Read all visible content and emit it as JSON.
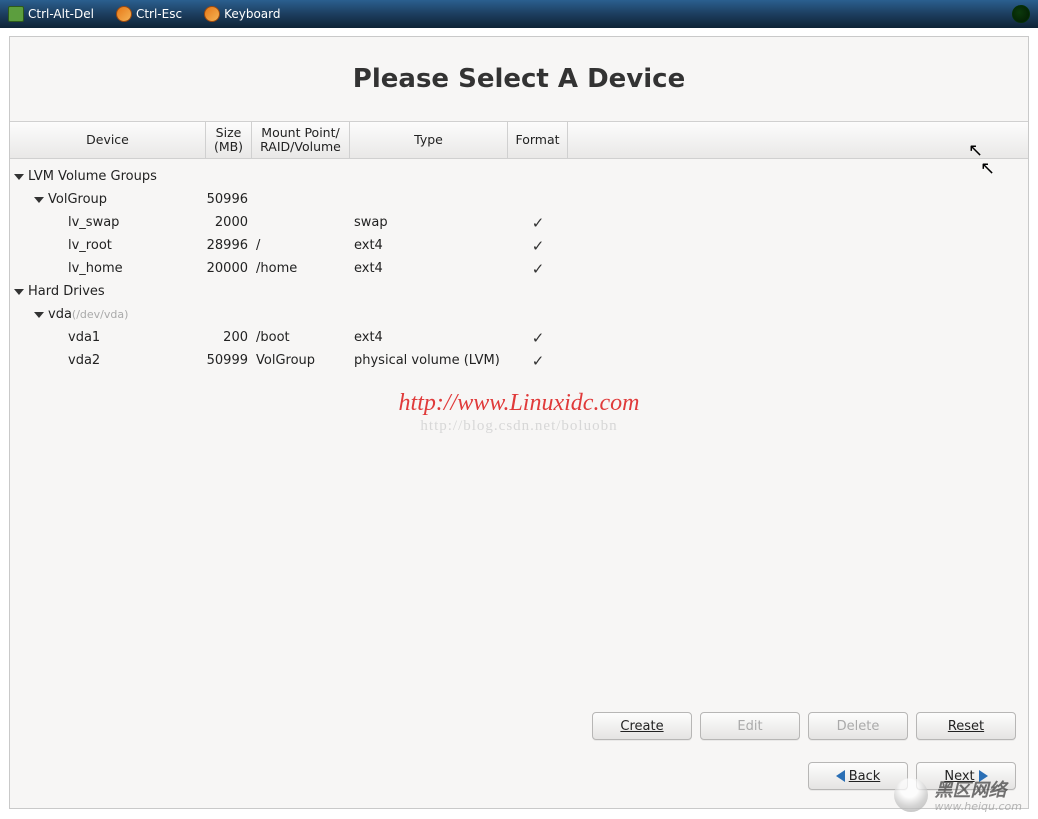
{
  "toolbar": {
    "items": [
      {
        "label": "Ctrl-Alt-Del"
      },
      {
        "label": "Ctrl-Esc"
      },
      {
        "label": "Keyboard"
      }
    ]
  },
  "title": "Please Select A Device",
  "columns": {
    "device": "Device",
    "size": "Size (MB)",
    "mount": "Mount Point/ RAID/Volume",
    "type": "Type",
    "format": "Format"
  },
  "rows": [
    {
      "level": 0,
      "expander": true,
      "device": "LVM Volume Groups"
    },
    {
      "level": 1,
      "expander": true,
      "device": "VolGroup",
      "size": "50996"
    },
    {
      "level": 2,
      "device": "lv_swap",
      "size": "2000",
      "mount": "",
      "type": "swap",
      "format": true
    },
    {
      "level": 2,
      "device": "lv_root",
      "size": "28996",
      "mount": "/",
      "type": "ext4",
      "format": true
    },
    {
      "level": 2,
      "device": "lv_home",
      "size": "20000",
      "mount": "/home",
      "type": "ext4",
      "format": true
    },
    {
      "level": 0,
      "expander": true,
      "device": "Hard Drives"
    },
    {
      "level": 1,
      "expander": true,
      "device": "vda",
      "dim": "(/dev/vda)"
    },
    {
      "level": 2,
      "device": "vda1",
      "size": "200",
      "mount": "/boot",
      "type": "ext4",
      "format": true
    },
    {
      "level": 2,
      "device": "vda2",
      "size": "50999",
      "mount": "VolGroup",
      "type": "physical volume (LVM)",
      "format": true
    }
  ],
  "buttons": {
    "create": "Create",
    "edit": "Edit",
    "delete": "Delete",
    "reset": "Reset",
    "back": "Back",
    "next": "Next"
  },
  "watermark": {
    "url": "http://www.Linuxidc.com",
    "faded": "http://blog.csdn.net/boluobn",
    "brand_cn": "黑区网络",
    "brand_en": "www.heiqu.com"
  }
}
